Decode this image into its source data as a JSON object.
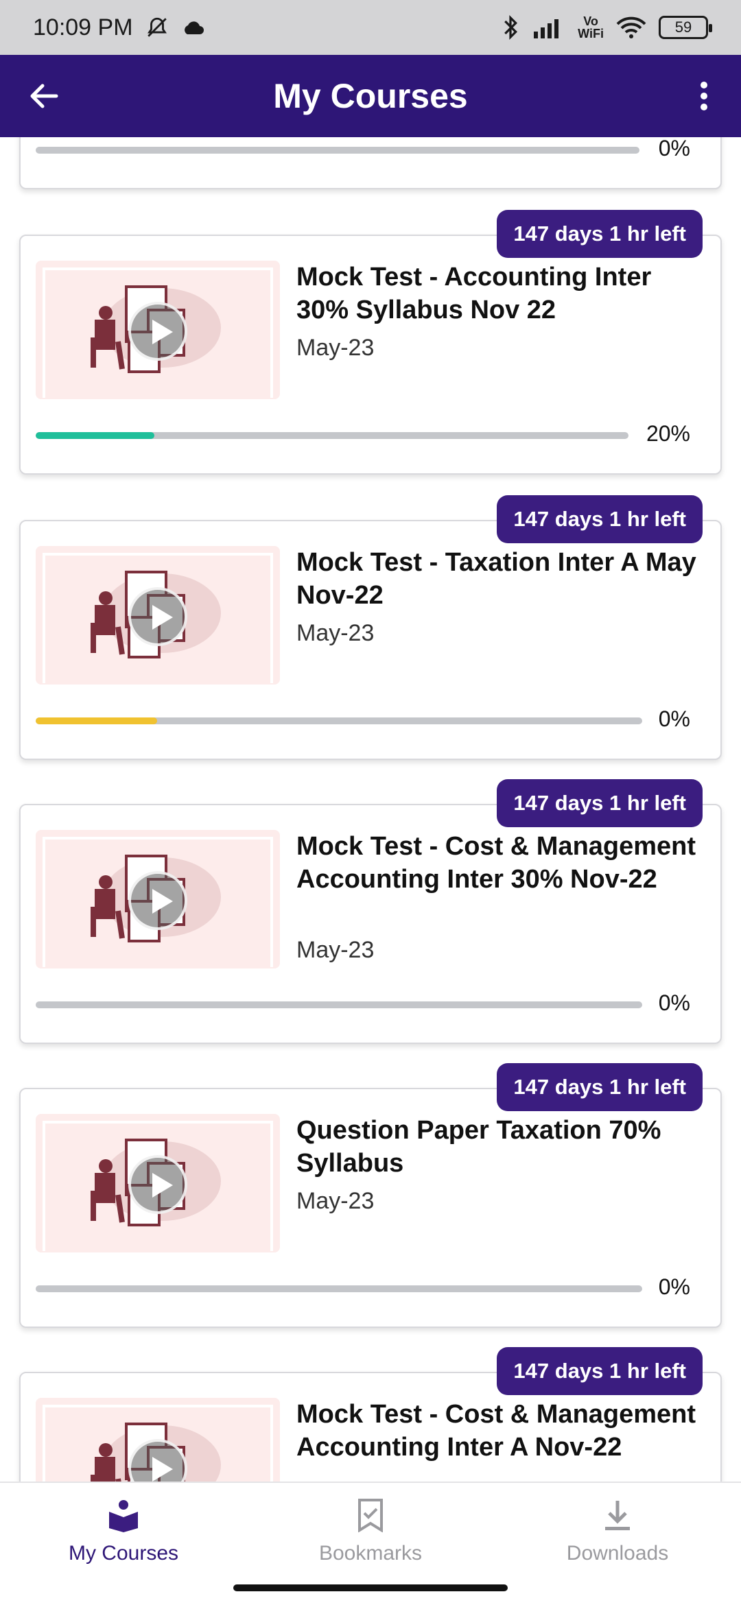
{
  "status_bar": {
    "time": "10:09 PM",
    "battery": "59",
    "network_label_1": "Vo",
    "network_label_2": "WiFi"
  },
  "app_bar": {
    "title": "My Courses"
  },
  "partial_card": {
    "progress_label": "0%"
  },
  "courses": [
    {
      "badge": "147 days 1 hr left",
      "title": "Mock Test - Accounting Inter 30% Syllabus Nov 22",
      "subtitle": "May-23",
      "progress": 0.2,
      "progress_label": "20%",
      "bar_color": "#1fbf9a"
    },
    {
      "badge": "147 days 1 hr left",
      "title": "Mock Test - Taxation Inter A May Nov-22",
      "subtitle": "May-23",
      "progress": 0.2,
      "progress_label": "0%",
      "bar_color": "#f0c230"
    },
    {
      "badge": "147 days 1 hr left",
      "title": "Mock Test - Cost & Management Accounting Inter 30% Nov-22",
      "subtitle": "May-23",
      "progress": 0,
      "progress_label": "0%",
      "bar_color": "#c4c6ca"
    },
    {
      "badge": "147 days 1 hr left",
      "title": "Question Paper Taxation 70% Syllabus",
      "subtitle": "May-23",
      "progress": 0,
      "progress_label": "0%",
      "bar_color": "#c4c6ca"
    },
    {
      "badge": "147 days 1 hr left",
      "title": "Mock Test - Cost & Management Accounting Inter A Nov-22",
      "subtitle": "",
      "progress": 0,
      "progress_label": "",
      "bar_color": "#c4c6ca"
    }
  ],
  "bottom_nav": {
    "items": [
      {
        "label": "My Courses",
        "icon": "book-reader-icon",
        "active": true
      },
      {
        "label": "Bookmarks",
        "icon": "bookmark-check-icon",
        "active": false
      },
      {
        "label": "Downloads",
        "icon": "download-icon",
        "active": false
      }
    ]
  },
  "colors": {
    "primary": "#2e1677",
    "badge": "#3b1d80",
    "inactive_nav": "#9a9a9e"
  }
}
